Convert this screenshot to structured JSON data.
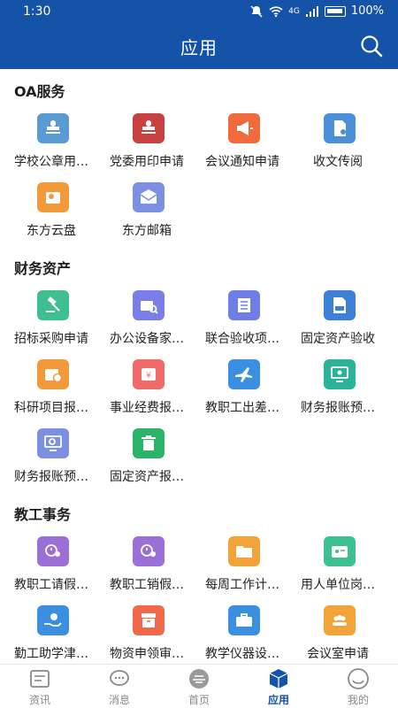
{
  "status": {
    "time": "1:30",
    "network": "4G",
    "battery": "100%"
  },
  "header": {
    "title": "应用",
    "search_icon": "search-icon"
  },
  "sections": [
    {
      "title": "OA服务",
      "apps": [
        {
          "label": "学校公章用…",
          "icon": "stamp-icon",
          "color": "#5b9bd5"
        },
        {
          "label": "党委用印申请",
          "icon": "stamp-icon",
          "color": "#c94040"
        },
        {
          "label": "会议通知申请",
          "icon": "megaphone-icon",
          "color": "#f06a3c"
        },
        {
          "label": "收文传阅",
          "icon": "document-icon",
          "color": "#4a90d9"
        },
        {
          "label": "东方云盘",
          "icon": "cloud-folder-icon",
          "color": "#f29a3a"
        },
        {
          "label": "东方邮箱",
          "icon": "mail-icon",
          "color": "#7d8fe0"
        }
      ]
    },
    {
      "title": "财务资产",
      "apps": [
        {
          "label": "招标采购申请",
          "icon": "gavel-icon",
          "color": "#3dbf8f"
        },
        {
          "label": "办公设备家…",
          "icon": "briefcase-search-icon",
          "color": "#7b7de8"
        },
        {
          "label": "联合验收项…",
          "icon": "list-icon",
          "color": "#6f7ee6"
        },
        {
          "label": "固定资产验收",
          "icon": "check-document-icon",
          "color": "#3b7fd6"
        },
        {
          "label": "科研项目报…",
          "icon": "coin-folder-icon",
          "color": "#f29a3a"
        },
        {
          "label": "事业经费报…",
          "icon": "yuan-card-icon",
          "color": "#f06a6a"
        },
        {
          "label": "教职工出差…",
          "icon": "airplane-icon",
          "color": "#3b8fe0"
        },
        {
          "label": "财务报账预…",
          "icon": "monitor-icon",
          "color": "#2bb39a"
        },
        {
          "label": "财务报账预…",
          "icon": "monitor-search-icon",
          "color": "#7d8fe0"
        },
        {
          "label": "固定资产报…",
          "icon": "trash-icon",
          "color": "#2bb36a"
        }
      ]
    },
    {
      "title": "教工事务",
      "apps": [
        {
          "label": "教职工请假…",
          "icon": "clock-person-icon",
          "color": "#9b6fd6"
        },
        {
          "label": "教职工销假…",
          "icon": "clock-person-icon",
          "color": "#9b6fd6"
        },
        {
          "label": "每周工作计…",
          "icon": "folder-icon",
          "color": "#f2a33a"
        },
        {
          "label": "用人单位岗…",
          "icon": "id-card-icon",
          "color": "#3dbf8f"
        },
        {
          "label": "勤工助学津…",
          "icon": "hand-coin-icon",
          "color": "#3b8fe0"
        },
        {
          "label": "物资申领审…",
          "icon": "archive-icon",
          "color": "#f06a4a"
        },
        {
          "label": "教学仪器设…",
          "icon": "toolbox-icon",
          "color": "#3b8fe0"
        },
        {
          "label": "会议室申请",
          "icon": "people-icon",
          "color": "#f2a33a"
        }
      ]
    }
  ],
  "bottom_nav": [
    {
      "label": "资讯",
      "icon": "news-icon",
      "active": false
    },
    {
      "label": "消息",
      "icon": "chat-icon",
      "active": false
    },
    {
      "label": "首页",
      "icon": "home-logo-icon",
      "active": false
    },
    {
      "label": "应用",
      "icon": "apps-cube-icon",
      "active": true
    },
    {
      "label": "我的",
      "icon": "profile-icon",
      "active": false
    }
  ],
  "colors": {
    "header_bg": "#1553a8",
    "accent": "#1553a8",
    "inactive": "#888888"
  }
}
